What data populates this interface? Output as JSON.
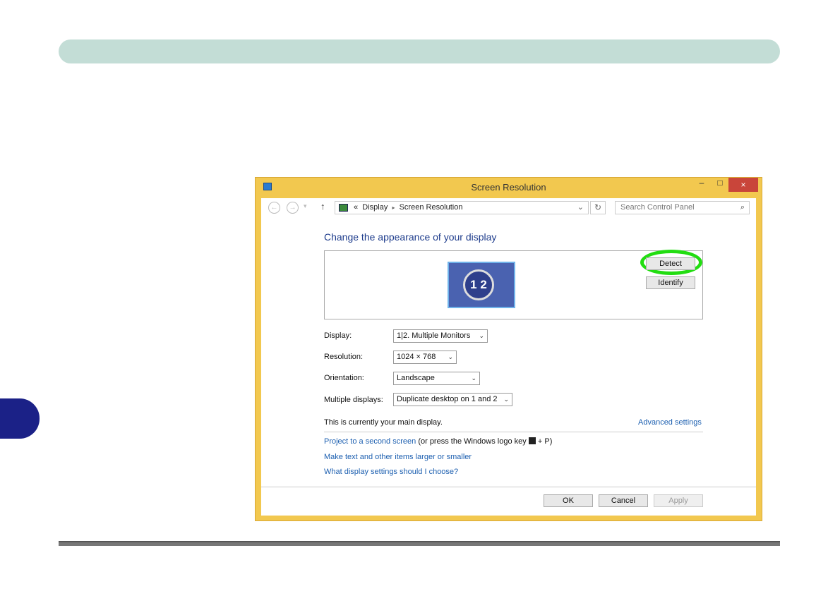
{
  "window": {
    "title": "Screen Resolution",
    "close": "×",
    "minimize": "–",
    "maximize": "□"
  },
  "nav": {
    "back": "←",
    "forward": "→",
    "dropdown": "▾",
    "up": "↑",
    "breadcrumb_sep": "«",
    "crumb1": "Display",
    "crumb_arrow": "▸",
    "crumb2": "Screen Resolution",
    "addr_chev": "⌄",
    "refresh": "↻",
    "search_placeholder": "Search Control Panel",
    "search_icon": "⌕"
  },
  "main": {
    "heading": "Change the appearance of your display",
    "monitor_label": "1 2",
    "detect": "Detect",
    "identify": "Identify",
    "display_label": "Display:",
    "display_value": "1|2. Multiple Monitors",
    "resolution_label": "Resolution:",
    "resolution_value": "1024 × 768",
    "orientation_label": "Orientation:",
    "orientation_value": "Landscape",
    "multiple_label": "Multiple displays:",
    "multiple_value": "Duplicate desktop on 1 and 2",
    "main_display_text": "This is currently your main display.",
    "advanced": "Advanced settings",
    "project_link": "Project to a second screen",
    "project_hint_pre": "(or press the Windows logo key",
    "project_hint_post": "+ P)",
    "text_size_link": "Make text and other items larger or smaller",
    "choose_link": "What display settings should I choose?",
    "ok": "OK",
    "cancel": "Cancel",
    "apply": "Apply"
  },
  "colors": {
    "accent": "#1c5fb0",
    "frame": "#f2c84f",
    "highlight": "#22dd11",
    "tab": "#1b2187"
  }
}
